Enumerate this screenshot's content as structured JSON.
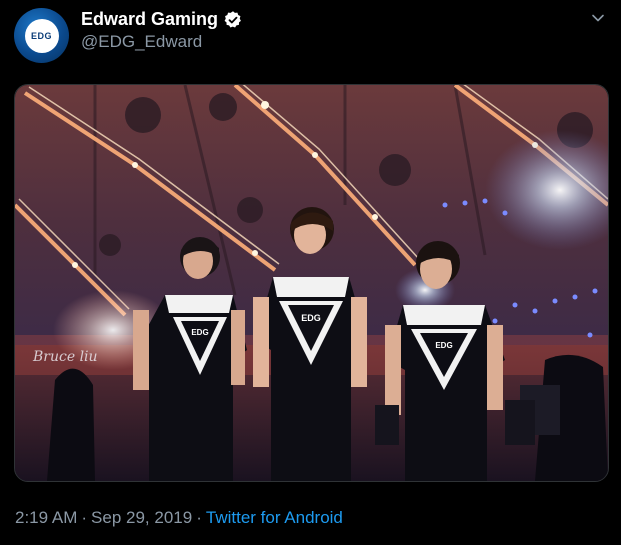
{
  "tweet": {
    "author": {
      "display_name": "Edward Gaming",
      "handle": "@EDG_Edward",
      "verified": true,
      "avatar_text": "EDG"
    },
    "photo": {
      "watermark": "Bruce liu",
      "jersey_text": "EDG"
    },
    "footer": {
      "time": "2:19 AM",
      "separator": "·",
      "date": "Sep 29, 2019",
      "source": "Twitter for Android"
    },
    "icons": {
      "verified": "verified-badge-icon",
      "menu": "chevron-down-icon"
    },
    "colors": {
      "background": "#000000",
      "name": "#ffffff",
      "muted": "#8b98a5",
      "link": "#1d9bf0",
      "verified_badge": "#ffffff"
    }
  }
}
